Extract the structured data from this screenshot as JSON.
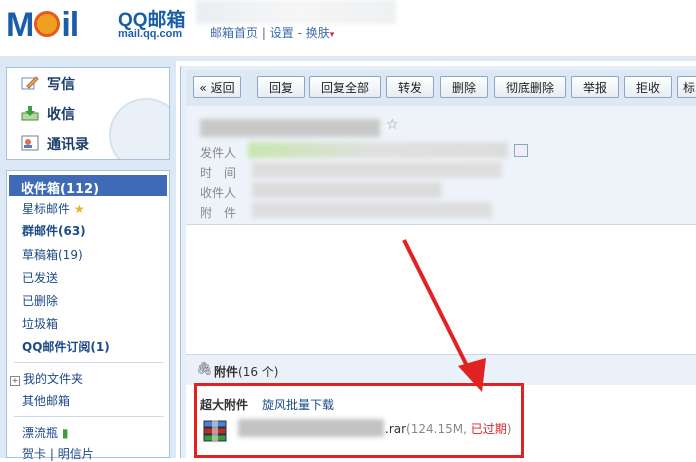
{
  "header": {
    "logo_text": "MOil",
    "logo_name": "QQ邮箱",
    "logo_url": "mail.qq.com",
    "links": [
      "邮箱首页",
      "设置",
      "换肤"
    ]
  },
  "sidebar": {
    "quick": [
      {
        "label": "写信",
        "icon": "compose-icon"
      },
      {
        "label": "收信",
        "icon": "inbox-download-icon"
      },
      {
        "label": "通讯录",
        "icon": "contacts-icon"
      }
    ],
    "folders": {
      "inbox": "收件箱(112)",
      "starred": "星标邮件",
      "group": "群邮件(63)",
      "drafts": "草稿箱(19)",
      "sent": "已发送",
      "deleted": "已删除",
      "spam": "垃圾箱",
      "subscriptions": "QQ邮件订阅(1)",
      "my_folders": "我的文件夹",
      "other": "其他邮箱",
      "bottle": "漂流瓶",
      "cards": "贺卡",
      "postcard": "明信片"
    }
  },
  "toolbar": {
    "buttons": [
      "« 返回",
      "回复",
      "回复全部",
      "转发",
      "删除",
      "彻底删除",
      "举报",
      "拒收",
      "标"
    ]
  },
  "mail": {
    "from_label": "发件人",
    "time_label": "时　间",
    "to_label": "收件人",
    "attach_label": "附　件"
  },
  "attachments": {
    "title": "附件",
    "count": "(16 个)",
    "super_label": "超大附件",
    "batch_link": "旋风批量下载",
    "file_ext": ".rar",
    "file_size": "(124.15M,",
    "expired": "已过期",
    "close_paren": ")"
  },
  "colors": {
    "accent": "#3e6ab7",
    "alert": "#e02222",
    "link": "#1b4a86"
  }
}
